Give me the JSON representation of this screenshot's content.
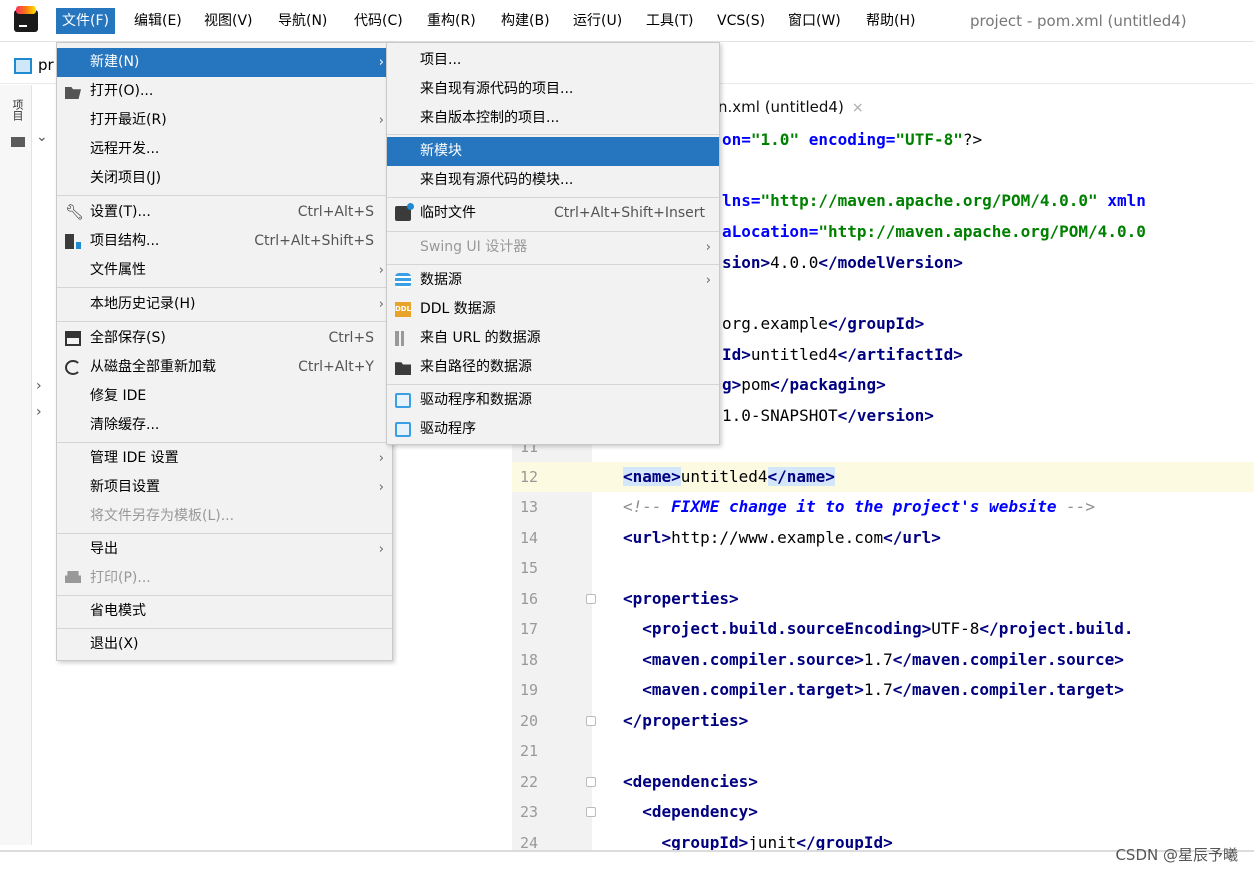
{
  "menubar": {
    "items": [
      {
        "label": "文件(F)"
      },
      {
        "label": "编辑(E)"
      },
      {
        "label": "视图(V)"
      },
      {
        "label": "导航(N)"
      },
      {
        "label": "代码(C)"
      },
      {
        "label": "重构(R)"
      },
      {
        "label": "构建(B)"
      },
      {
        "label": "运行(U)"
      },
      {
        "label": "工具(T)"
      },
      {
        "label": "VCS(S)"
      },
      {
        "label": "窗口(W)"
      },
      {
        "label": "帮助(H)"
      }
    ],
    "window_title": "project - pom.xml (untitled4)"
  },
  "nav": {
    "project_label": "pr"
  },
  "sidebar": {
    "tab_label": "项目"
  },
  "file_menu": {
    "items": [
      {
        "label": "新建(N)",
        "shortcut": "",
        "submenu": true
      },
      {
        "label": "打开(O)...",
        "shortcut": "",
        "submenu": false
      },
      {
        "label": "打开最近(R)",
        "shortcut": "",
        "submenu": true
      },
      {
        "label": "远程开发...",
        "shortcut": "",
        "submenu": false
      },
      {
        "label": "关闭项目(J)",
        "shortcut": "",
        "submenu": false
      },
      {
        "label": "设置(T)...",
        "shortcut": "Ctrl+Alt+S",
        "submenu": false
      },
      {
        "label": "项目结构...",
        "shortcut": "Ctrl+Alt+Shift+S",
        "submenu": false
      },
      {
        "label": "文件属性",
        "shortcut": "",
        "submenu": true
      },
      {
        "label": "本地历史记录(H)",
        "shortcut": "",
        "submenu": true
      },
      {
        "label": "全部保存(S)",
        "shortcut": "Ctrl+S",
        "submenu": false
      },
      {
        "label": "从磁盘全部重新加载",
        "shortcut": "Ctrl+Alt+Y",
        "submenu": false
      },
      {
        "label": "修复 IDE",
        "shortcut": "",
        "submenu": false
      },
      {
        "label": "清除缓存...",
        "shortcut": "",
        "submenu": false
      },
      {
        "label": "管理 IDE 设置",
        "shortcut": "",
        "submenu": true
      },
      {
        "label": "新项目设置",
        "shortcut": "",
        "submenu": true
      },
      {
        "label": "将文件另存为模板(L)...",
        "shortcut": "",
        "submenu": false
      },
      {
        "label": "导出",
        "shortcut": "",
        "submenu": true
      },
      {
        "label": "打印(P)...",
        "shortcut": "",
        "submenu": false
      },
      {
        "label": "省电模式",
        "shortcut": "",
        "submenu": false
      },
      {
        "label": "退出(X)",
        "shortcut": "",
        "submenu": false
      }
    ]
  },
  "new_submenu": {
    "items": [
      {
        "label": "项目..."
      },
      {
        "label": "来自现有源代码的项目..."
      },
      {
        "label": "来自版本控制的项目..."
      },
      {
        "label": "新模块"
      },
      {
        "label": "来自现有源代码的模块..."
      },
      {
        "label": "临时文件",
        "shortcut": "Ctrl+Alt+Shift+Insert"
      },
      {
        "label": "Swing UI 设计器"
      },
      {
        "label": "数据源"
      },
      {
        "label": "DDL 数据源"
      },
      {
        "label": "来自 URL 的数据源"
      },
      {
        "label": "来自路径的数据源"
      },
      {
        "label": "驱动程序和数据源"
      },
      {
        "label": "驱动程序"
      }
    ]
  },
  "editor": {
    "tab_label": "n.xml (untitled4)",
    "tab_close": "×",
    "partial_lines": [
      "on=\"1.0\" encoding=\"UTF-8\"?>",
      "lns=\"http://maven.apache.org/POM/4.0.0\" xmln",
      "aLocation=\"http://maven.apache.org/POM/4.0.0",
      "sion>4.0.0</modelVersion>",
      "org.example</groupId>",
      "Id>untitled4</artifactId>",
      "g>pom</packaging>",
      "1.0-SNAPSHOT</version>"
    ],
    "lines": [
      {
        "num": "11",
        "text": ""
      },
      {
        "num": "12",
        "text": "<name>untitled4</name>"
      },
      {
        "num": "13",
        "text": "<!-- FIXME change it to the project's website -->"
      },
      {
        "num": "14",
        "text": "<url>http://www.example.com</url>"
      },
      {
        "num": "15",
        "text": ""
      },
      {
        "num": "16",
        "text": "<properties>"
      },
      {
        "num": "17",
        "text": "  <project.build.sourceEncoding>UTF-8</project.build."
      },
      {
        "num": "18",
        "text": "  <maven.compiler.source>1.7</maven.compiler.source>"
      },
      {
        "num": "19",
        "text": "  <maven.compiler.target>1.7</maven.compiler.target>"
      },
      {
        "num": "20",
        "text": "</properties>"
      },
      {
        "num": "21",
        "text": ""
      },
      {
        "num": "22",
        "text": "<dependencies>"
      },
      {
        "num": "23",
        "text": "  <dependency>"
      },
      {
        "num": "24",
        "text": "    <groupId>junit</groupId>"
      }
    ]
  },
  "watermark": "CSDN @星辰予曦",
  "colors": {
    "selection": "#2675bf",
    "tag": "#000080",
    "string": "#008000",
    "comment": "#8c8c8c",
    "highlight_line": "#fcfae1"
  }
}
